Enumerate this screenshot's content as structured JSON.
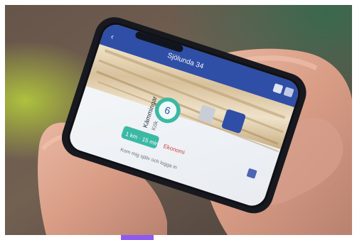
{
  "photo": {
    "description_hidden": false
  },
  "app": {
    "header_title": "Sjölunda 34",
    "score_number": "6",
    "item_title": "Kämmingar",
    "item_subtitle": "Kök",
    "teal_button_label": "1 km · 15 min",
    "status_label": "Ekonomi",
    "footer_hint": "Kom mig själv och logga in"
  },
  "colors": {
    "phone_frame": "#17191f",
    "app_header": "#2f4ea6",
    "teal": "#3bb9a4",
    "accent_purple": "#8e5bf2",
    "wood_light": "#e8d9bf",
    "wood_shadow": "#b79c6e"
  }
}
